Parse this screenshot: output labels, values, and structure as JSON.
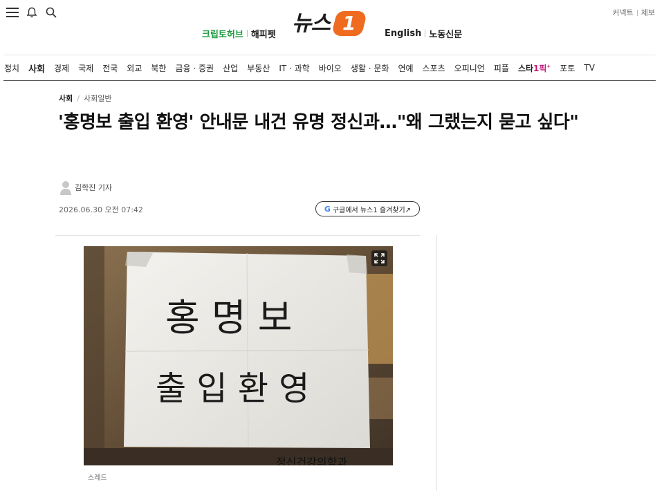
{
  "header": {
    "logo_text": "뉴스",
    "logo_badge": "1",
    "sub_left": [
      "크립토허브",
      "해피펫"
    ],
    "sub_right": [
      "English",
      "노동신문"
    ],
    "top_right": [
      "커넥트",
      "제보"
    ],
    "icons": [
      "menu-icon",
      "bell-icon",
      "search-icon"
    ]
  },
  "nav": {
    "items": [
      "정치",
      "사회",
      "경제",
      "국제",
      "전국",
      "외교",
      "북한",
      "금융 · 증권",
      "산업",
      "부동산",
      "IT · 과학",
      "바이오",
      "생활 · 문화",
      "연예",
      "스포츠",
      "오피니언",
      "피플"
    ],
    "star_prefix": "스타",
    "star_suffix": "1픽",
    "star_mark": "+",
    "tail_items": [
      "포토",
      "TV"
    ],
    "active": "사회"
  },
  "article": {
    "breadcrumb": [
      "사회",
      "사회일반"
    ],
    "headline": "'홍명보 출입 환영' 안내문 내건 유명 정신과…\"왜 그랬는지 묻고 싶다\"",
    "author": "김학진 기자",
    "date": "2026.06.30 오전 07:42",
    "google_button": "구글에서 뉴스1 즐겨찾기↗",
    "google_letter": "G",
    "photo_text_line1": "홍 명 보",
    "photo_text_line2": "출 입 환 영",
    "photo_bottom_text": "정신건강의학과",
    "caption": "스레드"
  },
  "colors": {
    "accent_orange": "#ef6b1f",
    "green_link": "#1d9a3f",
    "star_pink": "#c2187a"
  }
}
